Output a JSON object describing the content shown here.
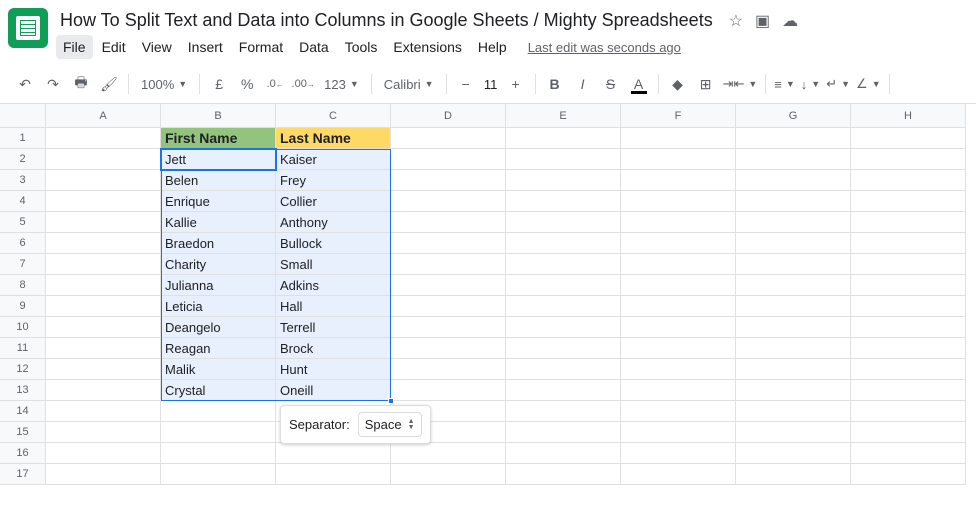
{
  "doc_title": "How To Split Text and Data into Columns in Google Sheets / Mighty Spreadsheets",
  "menus": [
    "File",
    "Edit",
    "View",
    "Insert",
    "Format",
    "Data",
    "Tools",
    "Extensions",
    "Help"
  ],
  "last_edit": "Last edit was seconds ago",
  "toolbar": {
    "zoom": "100%",
    "currency": "£",
    "percent": "%",
    "dec_dec": ".0",
    "inc_dec": ".00",
    "more_formats": "123",
    "font_name": "Calibri",
    "font_size": "11"
  },
  "columns": [
    {
      "label": "A",
      "width": 115
    },
    {
      "label": "B",
      "width": 115
    },
    {
      "label": "C",
      "width": 115
    },
    {
      "label": "D",
      "width": 115
    },
    {
      "label": "E",
      "width": 115
    },
    {
      "label": "F",
      "width": 115
    },
    {
      "label": "G",
      "width": 115
    },
    {
      "label": "H",
      "width": 115
    }
  ],
  "row_count": 17,
  "headers": {
    "b": "First Name",
    "c": "Last Name"
  },
  "data_rows": [
    {
      "b": "Jett",
      "c": "Kaiser"
    },
    {
      "b": "Belen",
      "c": "Frey"
    },
    {
      "b": "Enrique",
      "c": "Collier"
    },
    {
      "b": "Kallie",
      "c": "Anthony"
    },
    {
      "b": "Braedon",
      "c": "Bullock"
    },
    {
      "b": "Charity",
      "c": "Small"
    },
    {
      "b": "Julianna",
      "c": "Adkins"
    },
    {
      "b": "Leticia",
      "c": "Hall"
    },
    {
      "b": "Deangelo",
      "c": "Terrell"
    },
    {
      "b": "Reagan",
      "c": "Brock"
    },
    {
      "b": "Malik",
      "c": "Hunt"
    },
    {
      "b": "Crystal",
      "c": "Oneill"
    }
  ],
  "separator": {
    "label": "Separator:",
    "value": "Space"
  },
  "chart_data": {
    "type": "table",
    "title": "How To Split Text and Data into Columns in Google Sheets / Mighty Spreadsheets",
    "columns": [
      "First Name",
      "Last Name"
    ],
    "rows": [
      [
        "Jett",
        "Kaiser"
      ],
      [
        "Belen",
        "Frey"
      ],
      [
        "Enrique",
        "Collier"
      ],
      [
        "Kallie",
        "Anthony"
      ],
      [
        "Braedon",
        "Bullock"
      ],
      [
        "Charity",
        "Small"
      ],
      [
        "Julianna",
        "Adkins"
      ],
      [
        "Leticia",
        "Hall"
      ],
      [
        "Deangelo",
        "Terrell"
      ],
      [
        "Reagan",
        "Brock"
      ],
      [
        "Malik",
        "Hunt"
      ],
      [
        "Crystal",
        "Oneill"
      ]
    ]
  }
}
